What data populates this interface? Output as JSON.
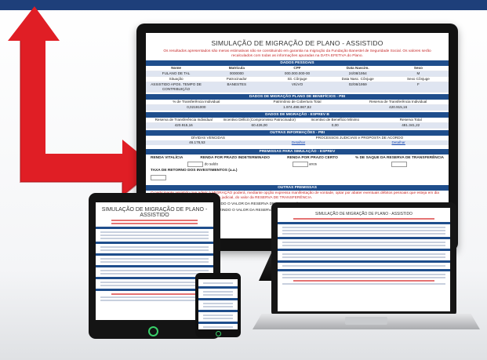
{
  "brand_color": "#1e3f7a",
  "arrow_color": "#e01e25",
  "monitor": {
    "title": "SIMULAÇÃO DE MIGRAÇÃO DE PLANO - ASSISTIDO",
    "warning": "Os resultados apresentados são meras estimativas não se constituindo em garantia na migração da Fundação Banestel de Seguridade Social. Os valores serão recalculados com todas as informações apuradas na DATA EFETIVA do Plano.",
    "sections": {
      "dados_pessoais": "DADOS PESSOAIS",
      "beneficios": "DADOS DE MIGRAÇÃO PLANO DE BENEFÍCIOS - PBI",
      "migracao": "DADOS DE MIGRAÇÃO - ESPREV B",
      "outras_info": "OUTRAS INFORMAÇÕES - PBI",
      "premissas": "PREMISSAS PARA SIMULAÇÃO - ESPREV",
      "outras_premissas": "OUTRAS PREMISSAS"
    },
    "personal_headers": [
      "Nome",
      "Matrícula",
      "CPF",
      "Data Nascim.",
      "Sexo"
    ],
    "personal_values": [
      "FULANO DE TAL",
      "0000000",
      "000.000.000-00",
      "24/08/1954",
      "M"
    ],
    "status_headers": [
      "Situação",
      "Patrocinador",
      "Sit. Cônjuge",
      "Data Nasc. Cônjuge",
      "Sexo Cônjuge"
    ],
    "status_values": [
      "ASSISTIDO APOS. TEMPO DE CONTRIBUIÇÃO",
      "BANESTES",
      "VIÚVO",
      "02/06/1959",
      "F"
    ],
    "benef_headers": [
      "% de Transferência Individual",
      "Patrimônio de Cobertura Total",
      "Reserva de Transferência Individual"
    ],
    "benef_values": [
      "0,02191000",
      "1.974.498.967,82",
      "420.915,16"
    ],
    "mig_headers": [
      "Reserva de Transferência Individual",
      "Incentivo Déficit (Compromisso Patrocinador)",
      "Incentivo de Benefício Mínimo",
      "Reserva Total"
    ],
    "mig_values": [
      "420.915,16",
      "60.426,00",
      "0,00",
      "481.341,22"
    ],
    "outras_headers": [
      "DÍVIDAS VENCIDAS",
      "PROCESSOS JUDICIAIS e PROPOSTA DE ACORDO"
    ],
    "outras_values": [
      "46.178,53",
      "Detalhar",
      "Detalhar"
    ],
    "premissas_labels": [
      "RENDA VITALÍCIA",
      "RENDA POR PRAZO INDETERMINADO",
      "RENDA POR PRAZO CERTO",
      "% DE SAQUE DA RESERVA DE TRANSFERÊNCIA"
    ],
    "premissa_units": [
      "do saldo",
      "anos"
    ],
    "taxa_label": "TAXA DE RETORNO DOS INVESTIMENTOS (a.a.)",
    "outras_text_1": "O participante assistido que aderir à MIGRAÇÃO poderá, mediante opção expressa manifestação de vontade, optar por abater eventuais débitos pessoais que esteja em dia com o PBI, decorrentes no ato de decisão judicial, do valor da RESERVA DE TRANSFERÊNCIA.",
    "option_1": "QUITAR A DÍVIDA COM O PBI, DEDUZINDO O VALOR DA RESERVA DE TRANSFERÊNCIA?",
    "option_2": "PARCIAL DA DÍVIDA COM O PBI, DEDUZINDO O VALOR DA RESERVA DE TRANSFERÊNCIA?"
  },
  "tablet": {
    "title": "SIMULAÇÃO DE MIGRAÇÃO DE PLANO - ASSISTIDO"
  },
  "laptop": {
    "title": "SIMULAÇÃO DE MIGRAÇÃO DE PLANO - ASSISTIDO"
  }
}
